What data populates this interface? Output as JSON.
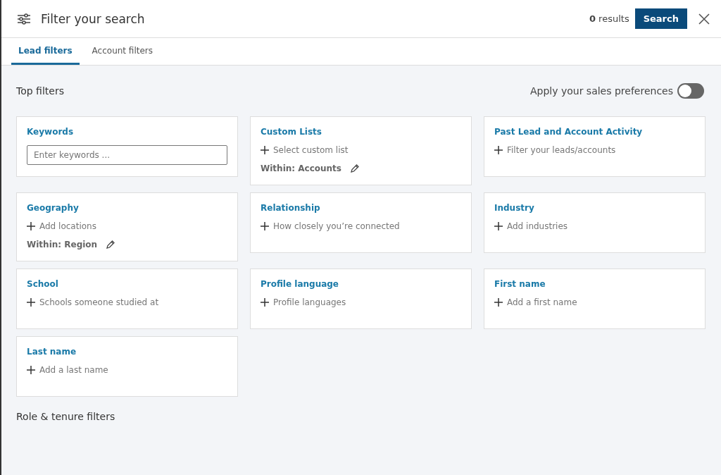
{
  "header": {
    "title": "Filter your search",
    "results": "**0** results",
    "search_button": "Search"
  },
  "tabs": [
    {
      "label": "Lead filters",
      "selected": true
    },
    {
      "label": "Account filters",
      "selected": false
    }
  ],
  "top_filters": {
    "heading": "Top filters",
    "preference_label": "Apply your sales preferences",
    "preference_on": false
  },
  "cards": [
    {
      "kind": "input",
      "title": "Keywords",
      "placeholder": "Enter keywords ..."
    },
    {
      "kind": "add",
      "title": "Custom Lists",
      "action": "Select custom list",
      "within": "Within: Accounts"
    },
    {
      "kind": "add",
      "title": "Past Lead and Account Activity",
      "action": "Filter your leads/accounts"
    },
    {
      "kind": "add",
      "title": "Geography",
      "action": "Add locations",
      "within": "Within: Region"
    },
    {
      "kind": "add",
      "title": "Relationship",
      "action": "How closely you’re connected"
    },
    {
      "kind": "add",
      "title": "Industry",
      "action": "Add industries"
    },
    {
      "kind": "add",
      "title": "School",
      "action": "Schools someone studied at"
    },
    {
      "kind": "add",
      "title": "Profile language",
      "action": "Profile languages"
    },
    {
      "kind": "add",
      "title": "First name",
      "action": "Add a first name"
    },
    {
      "kind": "add",
      "title": "Last name",
      "action": "Add a last name"
    }
  ],
  "section_heading": "Role & tenure filters"
}
